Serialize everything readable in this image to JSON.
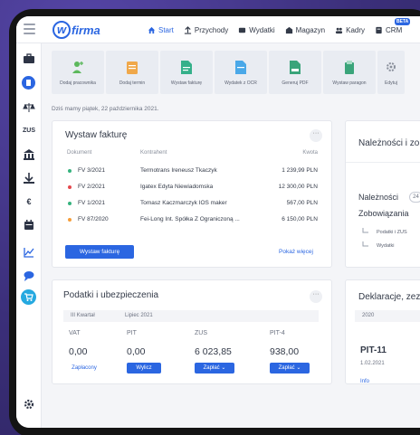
{
  "app": {
    "logo_mark": "w",
    "logo_text": "firma",
    "beta_badge": "BETA"
  },
  "nav": [
    {
      "label": "Start",
      "icon": "home-icon",
      "active": true
    },
    {
      "label": "Przychody",
      "icon": "income-icon",
      "active": false
    },
    {
      "label": "Wydatki",
      "icon": "expenses-icon",
      "active": false
    },
    {
      "label": "Magazyn",
      "icon": "warehouse-icon",
      "active": false
    },
    {
      "label": "Kadry",
      "icon": "people-icon",
      "active": false
    },
    {
      "label": "CRM",
      "icon": "crm-icon",
      "active": false
    }
  ],
  "sidebar": {
    "items": [
      {
        "icon": "briefcase-icon"
      },
      {
        "icon": "document-circle-icon"
      },
      {
        "icon": "scales-icon"
      },
      {
        "icon": "zus-icon",
        "text": "ZUS"
      },
      {
        "icon": "bank-icon"
      },
      {
        "icon": "download-icon"
      },
      {
        "icon": "euro-icon"
      },
      {
        "icon": "calendar-icon"
      },
      {
        "icon": "chart-icon"
      },
      {
        "icon": "chat-icon"
      },
      {
        "icon": "cart-circle-icon"
      },
      {
        "icon": "gear-icon"
      }
    ]
  },
  "quick_actions": [
    {
      "label": "Dodaj pracownika",
      "icon": "add-person-icon",
      "color": "#5cb85c"
    },
    {
      "label": "Dodaj termin",
      "icon": "calendar-add-icon",
      "color": "#f0a84a"
    },
    {
      "label": "Wystaw fakturę",
      "icon": "invoice-icon",
      "color": "#35b08a"
    },
    {
      "label": "Wydatek z OCR",
      "icon": "ocr-icon",
      "color": "#4aa8e8"
    },
    {
      "label": "Generuj PDF",
      "icon": "pdf-icon",
      "color": "#3aa47a"
    },
    {
      "label": "Wystaw paragon",
      "icon": "receipt-icon",
      "color": "#3aa47a"
    },
    {
      "label": "Edytuj",
      "icon": "gear-icon",
      "color": "#8a909c"
    }
  ],
  "date_line": "Dziś mamy piątek, 22 października 2021.",
  "invoice_card": {
    "title": "Wystaw fakturę",
    "more": "···",
    "columns": {
      "doc": "Dokument",
      "contractor": "Kontrahent",
      "amount": "Kwota"
    },
    "rows": [
      {
        "doc": "FV 3/2021",
        "contractor": "Termotrans Ireneusz Tkaczyk",
        "amount": "1 239,99 PLN",
        "status_color": "#36b37e"
      },
      {
        "doc": "FV 2/2021",
        "contractor": "Igatex Edyta Niewiadomska",
        "amount": "12 300,00 PLN",
        "status_color": "#e5484d"
      },
      {
        "doc": "FV 1/2021",
        "contractor": "Tomasz Kaczmarczyk IOS maker",
        "amount": "567,00 PLN",
        "status_color": "#36b37e"
      },
      {
        "doc": "FV 87/2020",
        "contractor": "Fei-Long Int. Spółka Z Ograniczoną ...",
        "amount": "6 150,00 PLN",
        "status_color": "#f59e3a"
      }
    ],
    "button": "Wystaw fakturę",
    "show_more": "Pokaż więcej"
  },
  "taxes_card": {
    "title": "Podatki i ubezpieczenia",
    "more": "···",
    "period_quarter": "III Kwartał",
    "period_month": "Lipiec 2021",
    "cols": [
      {
        "label": "VAT",
        "value": "0,00",
        "action": "Zapłacony",
        "style": "link"
      },
      {
        "label": "PIT",
        "value": "0,00",
        "action": "Wylicz",
        "style": "button"
      },
      {
        "label": "ZUS",
        "value": "6 023,85",
        "action": "Zapłać ⌄",
        "style": "button"
      },
      {
        "label": "PIT-4",
        "value": "938,00",
        "action": "Zapłać ⌄",
        "style": "button"
      }
    ]
  },
  "receivables_card": {
    "title": "Należności i zo",
    "line1": "Należności",
    "line1_badge": "24",
    "line2": "Zobowiązania",
    "sub1": "Podatki i ZUS",
    "sub2": "Wydatki"
  },
  "declarations_card": {
    "title": "Deklaracje, zez",
    "year": "2020",
    "form": "PIT-11",
    "date": "1.02.2021",
    "action": "Info"
  }
}
